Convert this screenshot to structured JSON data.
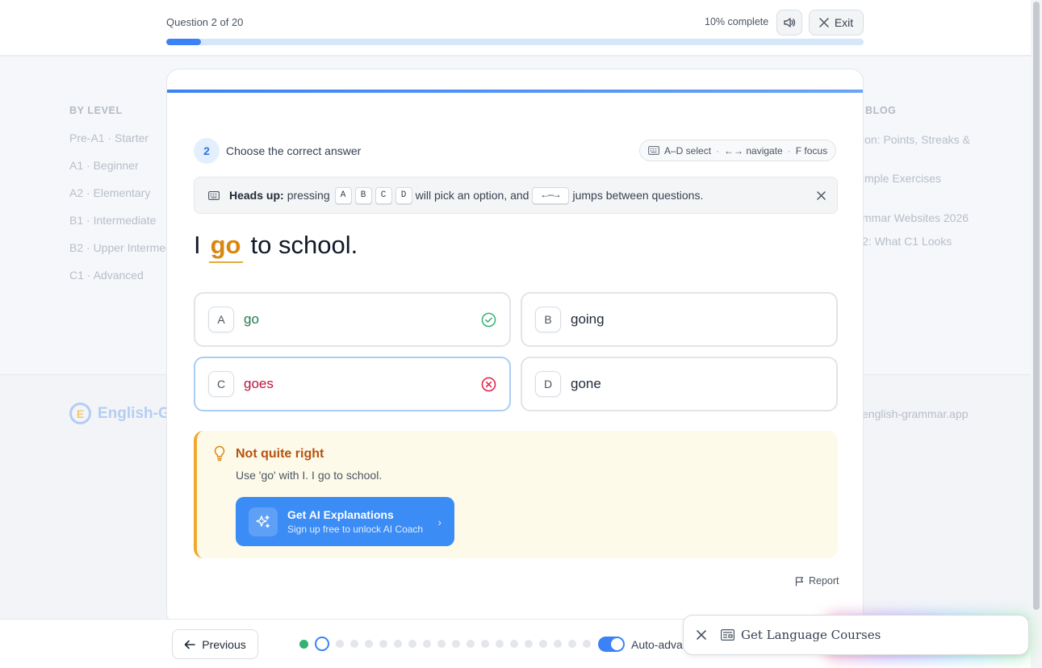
{
  "background": {
    "level_heading": "BY LEVEL",
    "levels": [
      "Pre-A1 · Starter",
      "A1 · Beginner",
      "A2 · Elementary",
      "B1 · Intermediate",
      "B2 · Upper Intermed",
      "C1 · Advanced"
    ],
    "blog_heading": "BLOG",
    "blog_links": [
      "ion: Points, Streaks &",
      "imple Exercises",
      "mmar Websites 2026",
      "2: What C1 Looks"
    ],
    "logo_mark": "E",
    "logo_text": "English-G",
    "email": "english-grammar.app"
  },
  "header": {
    "question_counter": "Question 2 of 20",
    "percent_text": "10% complete",
    "progress_fraction": 0.05,
    "exit_label": "Exit"
  },
  "question": {
    "number": "2",
    "prompt": "Choose the correct answer",
    "shortcuts": [
      "A–D select",
      "←→ navigate",
      "F focus"
    ],
    "shortcut_separator": "·",
    "heads_up": {
      "bold": "Heads up:",
      "pressing": "pressing",
      "keys": [
        "A",
        "B",
        "C",
        "D"
      ],
      "mid": "will pick an option, and",
      "arrow_key": "←—→",
      "end": "jumps between questions."
    },
    "sentence": {
      "before": "I",
      "answer": "go",
      "after": "to school."
    }
  },
  "options": [
    {
      "letter": "A",
      "text": "go",
      "status": "correct"
    },
    {
      "letter": "B",
      "text": "going",
      "status": ""
    },
    {
      "letter": "C",
      "text": "goes",
      "status": "wrong"
    },
    {
      "letter": "D",
      "text": "gone",
      "status": ""
    }
  ],
  "feedback": {
    "title": "Not quite right",
    "body": "Use 'go' with I. I go to school.",
    "ai_title": "Get AI Explanations",
    "ai_subtitle": "Sign up free to unlock AI Coach",
    "chevron": "›"
  },
  "report_label": "Report",
  "bottom": {
    "previous_label": "Previous",
    "total_questions": 20,
    "current_question": 2,
    "auto_advance_label": "Auto-adva"
  },
  "promo": {
    "text": "Get Language Courses"
  },
  "colors": {
    "accent": "#3b82f6",
    "correct": "#34b274",
    "wrong": "#e11d48",
    "warning": "#f0a92c"
  }
}
